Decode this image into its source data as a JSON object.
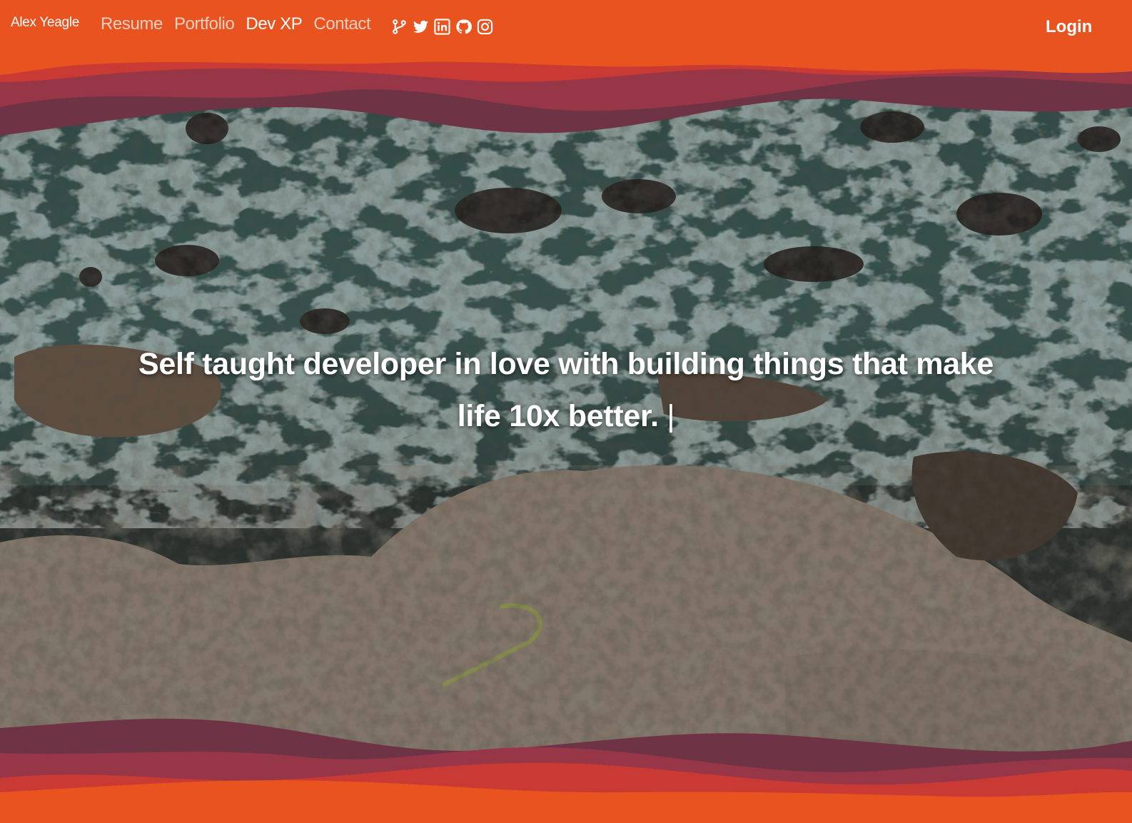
{
  "nav": {
    "brand": "Alex Yeagle",
    "links": [
      {
        "label": "Resume",
        "active": false
      },
      {
        "label": "Portfolio",
        "active": false
      },
      {
        "label": "Dev XP",
        "active": true
      },
      {
        "label": "Contact",
        "active": false
      }
    ],
    "socials": [
      "git-branch-icon",
      "twitter-icon",
      "linkedin-icon",
      "github-icon",
      "instagram-icon"
    ],
    "login": "Login"
  },
  "hero": {
    "tagline": "Self taught developer in love with building things that make life 10x better.",
    "cursor": "|"
  },
  "colors": {
    "accent": "#e8531f",
    "wave_red": "#c93a35",
    "wave_plum": "#8f3345",
    "wave_dark": "#6a3444",
    "text": "#ffffff"
  }
}
